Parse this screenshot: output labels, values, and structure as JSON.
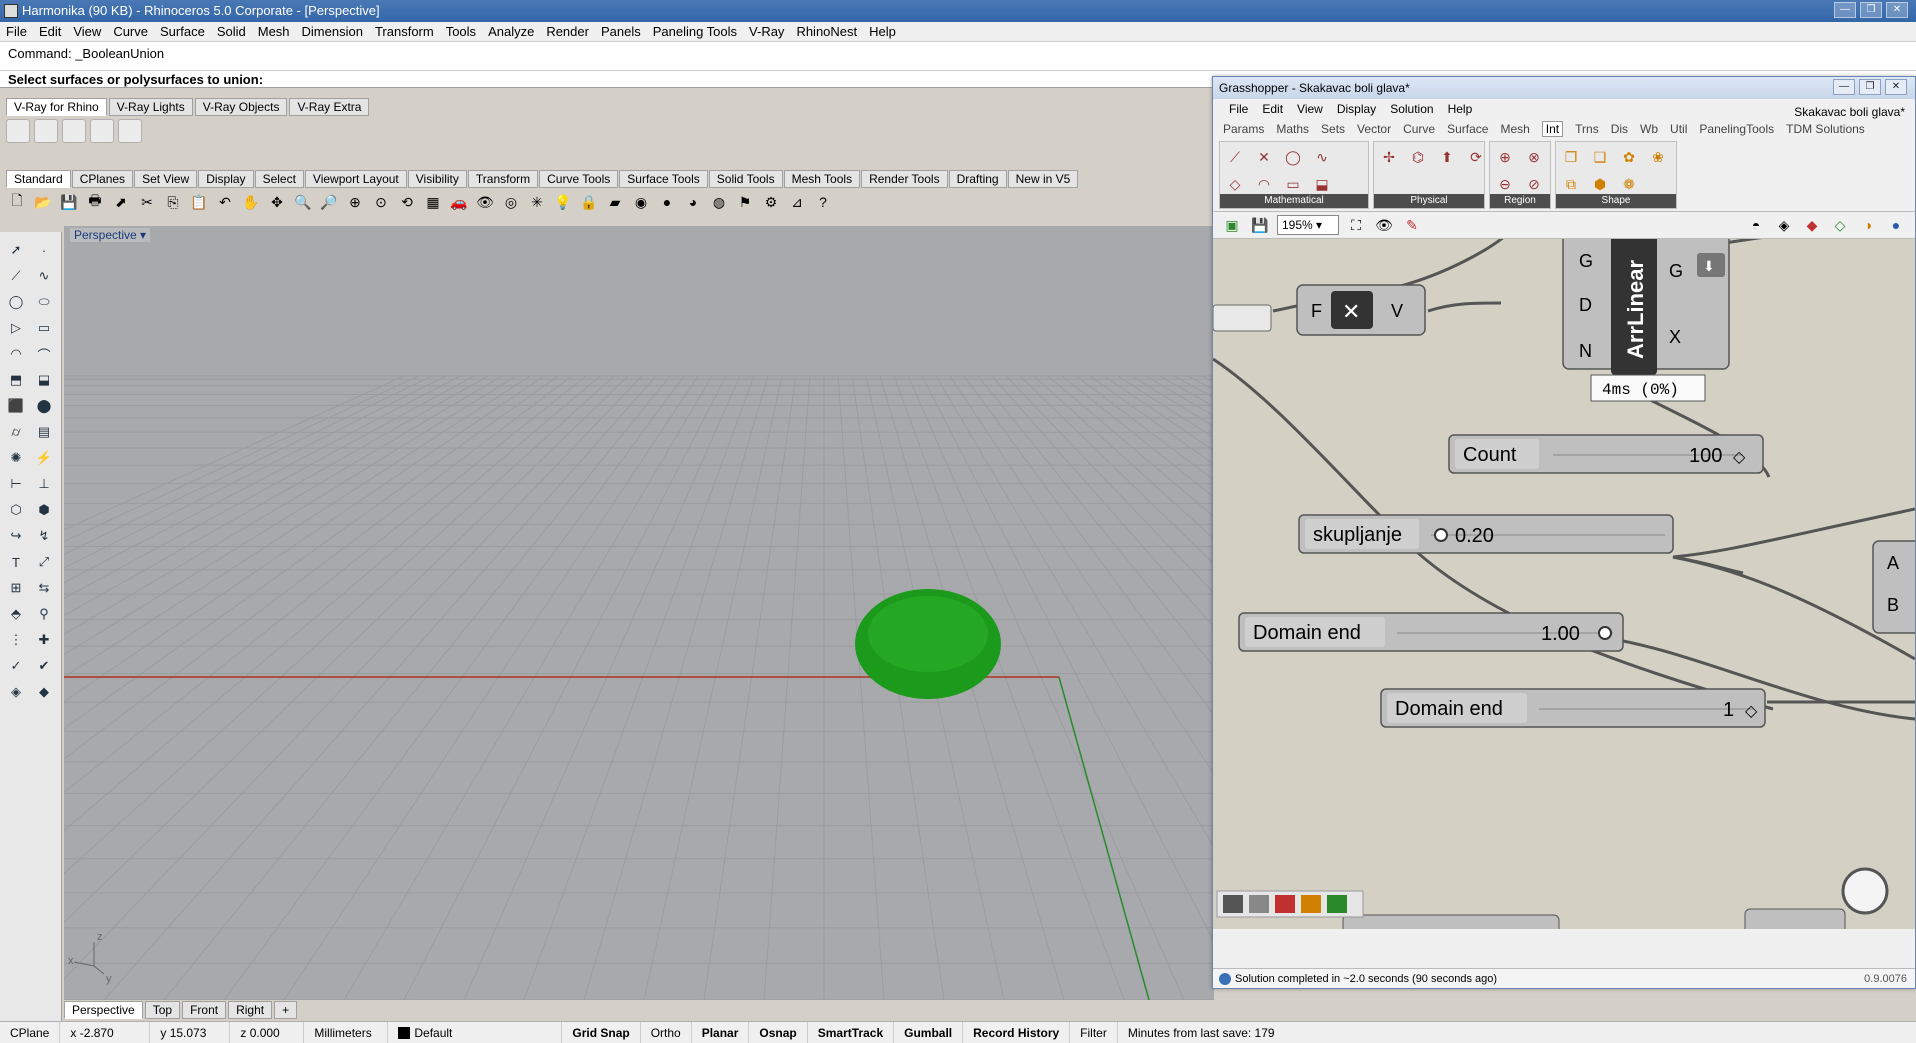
{
  "rhino": {
    "title": "Harmonika (90 KB) - Rhinoceros  5.0 Corporate - [Perspective]",
    "menu": [
      "File",
      "Edit",
      "View",
      "Curve",
      "Surface",
      "Solid",
      "Mesh",
      "Dimension",
      "Transform",
      "Tools",
      "Analyze",
      "Render",
      "Panels",
      "Paneling Tools",
      "V-Ray",
      "RhinoNest",
      "Help"
    ],
    "command_history": "Command: _BooleanUnion",
    "command_prompt": "Select surfaces or polysurfaces to union:",
    "vray_tabs": [
      "V-Ray for Rhino",
      "V-Ray Lights",
      "V-Ray Objects",
      "V-Ray Extra"
    ],
    "std_tabs": [
      "Standard",
      "CPlanes",
      "Set View",
      "Display",
      "Select",
      "Viewport Layout",
      "Visibility",
      "Transform",
      "Curve Tools",
      "Surface Tools",
      "Solid Tools",
      "Mesh Tools",
      "Render Tools",
      "Drafting",
      "New in V5"
    ],
    "viewport_label": "Perspective",
    "axis_labels": {
      "x": "x",
      "y": "y",
      "z": "z"
    },
    "bottom_tabs": [
      "Perspective",
      "Top",
      "Front",
      "Right",
      "+"
    ],
    "status": {
      "cplane": "CPlane",
      "x": "x -2.870",
      "y": "y 15.073",
      "z": "z 0.000",
      "units": "Millimeters",
      "layer": "Default",
      "toggles": [
        "Grid Snap",
        "Ortho",
        "Planar",
        "Osnap",
        "SmartTrack",
        "Gumball",
        "Record History"
      ],
      "filter": "Filter",
      "save_info": "Minutes from last save: 179"
    },
    "colors": {
      "object": "#1a9a1a",
      "x_axis": "#b03020",
      "y_axis": "#2a8a2a"
    }
  },
  "gh": {
    "title": "Grasshopper - Skakavac boli glava*",
    "menu": [
      "File",
      "Edit",
      "View",
      "Display",
      "Solution",
      "Help"
    ],
    "doc_name": "Skakavac boli glava*",
    "tabs": [
      "Params",
      "Maths",
      "Sets",
      "Vector",
      "Curve",
      "Surface",
      "Mesh",
      "Int",
      "Trns",
      "Dis",
      "Wb",
      "Util",
      "PanelingTools",
      "TDM Solutions"
    ],
    "active_tab": "Int",
    "ribbon_groups": [
      "Mathematical",
      "Physical",
      "Region",
      "Shape"
    ],
    "zoom": "195%",
    "nodes": {
      "arrlinear": {
        "name": "ArrLinear",
        "inputs": [
          "G",
          "D",
          "N"
        ],
        "outputs": [
          "G",
          "X"
        ],
        "profile": "4ms (0%)"
      },
      "negate": {
        "input": "F",
        "output": "V",
        "symbol": "✕"
      },
      "count": {
        "label": "Count",
        "value": "100"
      },
      "skupljanje": {
        "label": "skupljanje",
        "value": "0.20"
      },
      "domain_end_1": {
        "label": "Domain end",
        "value": "1.00"
      },
      "domain_end_2": {
        "label": "Domain end",
        "value": "1"
      },
      "right_inputs": [
        "A",
        "B"
      ]
    },
    "status": "Solution completed in ~2.0 seconds (90 seconds ago)",
    "version": "0.9.0076"
  }
}
